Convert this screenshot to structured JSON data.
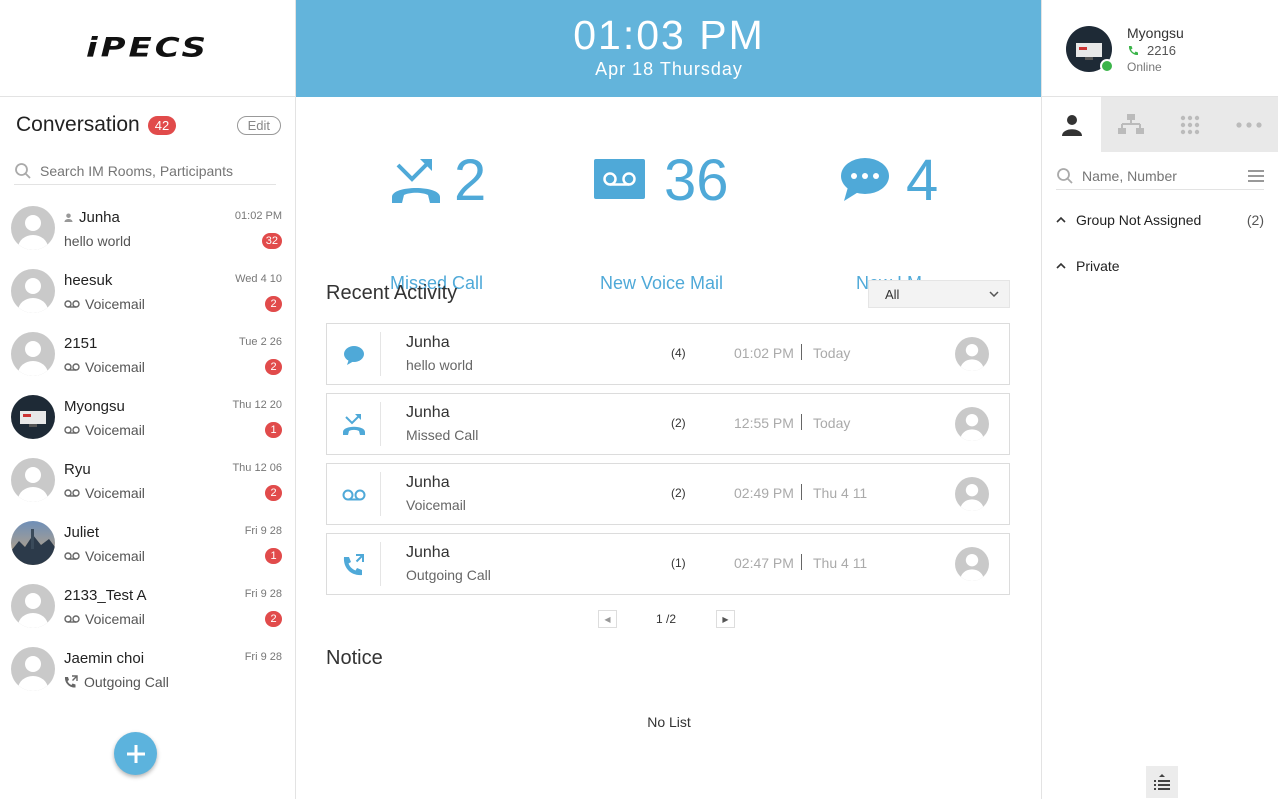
{
  "brand": {
    "logo_text": "iPECS"
  },
  "conversation": {
    "title": "Conversation",
    "count": "42",
    "edit_label": "Edit",
    "search_placeholder": "Search IM Rooms, Participants",
    "items": [
      {
        "name": "Junha",
        "time": "01:02 PM",
        "msg": "hello world",
        "count": "32",
        "msg_icon": "none",
        "avatar": "default",
        "name_icon": "person-icon"
      },
      {
        "name": "heesuk",
        "time": "Wed 4 10",
        "msg": "Voicemail",
        "count": "2",
        "msg_icon": "voicemail-icon",
        "avatar": "default"
      },
      {
        "name": "2151",
        "time": "Tue 2 26",
        "msg": "Voicemail",
        "count": "2",
        "msg_icon": "voicemail-icon",
        "avatar": "default"
      },
      {
        "name": "Myongsu",
        "time": "Thu 12 20",
        "msg": "Voicemail",
        "count": "1",
        "msg_icon": "voicemail-icon",
        "avatar": "photo-dark"
      },
      {
        "name": "Ryu",
        "time": "Thu 12 06",
        "msg": "Voicemail",
        "count": "2",
        "msg_icon": "voicemail-icon",
        "avatar": "default"
      },
      {
        "name": "Juliet",
        "time": "Fri 9 28",
        "msg": "Voicemail",
        "count": "1",
        "msg_icon": "voicemail-icon",
        "avatar": "photo-city"
      },
      {
        "name": "2133_Test A",
        "time": "Fri 9 28",
        "msg": "Voicemail",
        "count": "2",
        "msg_icon": "voicemail-icon",
        "avatar": "default"
      },
      {
        "name": "Jaemin choi",
        "time": "Fri 9 28",
        "msg": "Outgoing Call",
        "count": "",
        "msg_icon": "outgoing-call-icon",
        "avatar": "default"
      }
    ]
  },
  "clock": {
    "time": "01:03 PM",
    "date": "Apr 18 Thursday"
  },
  "stats": {
    "missed_call": {
      "value": "2",
      "label": "Missed Call"
    },
    "voice_mail": {
      "value": "36",
      "label": "New Voice Mail"
    },
    "im": {
      "value": "4",
      "label": "New I.M"
    }
  },
  "recent": {
    "title": "Recent Activity",
    "filter_value": "All",
    "items": [
      {
        "name": "Junha",
        "sub": "hello world",
        "count": "(4)",
        "time": "01:02 PM",
        "day": "Today",
        "icon": "chat-icon"
      },
      {
        "name": "Junha",
        "sub": "Missed Call",
        "count": "(2)",
        "time": "12:55 PM",
        "day": "Today",
        "icon": "missed-call-icon"
      },
      {
        "name": "Junha",
        "sub": "Voicemail",
        "count": "(2)",
        "time": "02:49 PM",
        "day": "Thu 4 11",
        "icon": "voicemail-icon"
      },
      {
        "name": "Junha",
        "sub": "Outgoing Call",
        "count": "(1)",
        "time": "02:47 PM",
        "day": "Thu 4 11",
        "icon": "outgoing-call-icon"
      }
    ],
    "pager": "1 /2"
  },
  "notice": {
    "title": "Notice",
    "empty": "No List"
  },
  "profile": {
    "name": "Myongsu",
    "ext": "2216",
    "status": "Online",
    "status_color": "#3bb44a"
  },
  "contacts": {
    "search_placeholder": "Name, Number",
    "groups": [
      {
        "label": "Group Not Assigned",
        "count": "(2)"
      },
      {
        "label": "Private",
        "count": ""
      }
    ]
  },
  "colors": {
    "accent": "#63b4db",
    "badge": "#e14b4b"
  }
}
